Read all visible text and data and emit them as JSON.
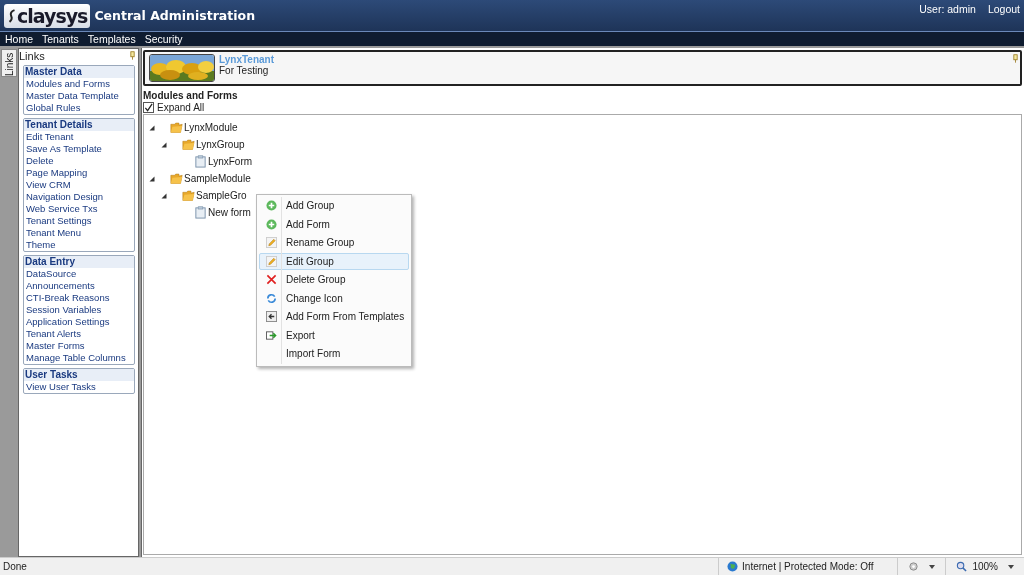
{
  "header": {
    "logo": "claysys",
    "title": "Central Administration",
    "user": "User: admin",
    "logout": "Logout"
  },
  "nav": [
    {
      "label": "Home"
    },
    {
      "label": "Tenants"
    },
    {
      "label": "Templates"
    },
    {
      "label": "Security"
    }
  ],
  "side_tab": "Links",
  "sidebar": {
    "title": "Links",
    "groups": [
      {
        "title": "Master Data",
        "items": [
          "Modules and Forms",
          "Master Data Template",
          "Global Rules"
        ]
      },
      {
        "title": "Tenant Details",
        "items": [
          "Edit Tenant",
          "Save As Template",
          "Delete",
          "Page Mapping",
          "View CRM",
          "Navigation Design",
          "Web Service Txs",
          "Tenant Settings",
          "Tenant Menu",
          "Theme"
        ]
      },
      {
        "title": "Data Entry",
        "items": [
          "DataSource",
          "Announcements",
          "CTI-Break Reasons",
          "Session Variables",
          "Application Settings",
          "Tenant Alerts",
          "Master Forms",
          "Manage Table Columns"
        ]
      },
      {
        "title": "User Tasks",
        "items": [
          "View User Tasks"
        ]
      }
    ]
  },
  "tenant": {
    "name": "LynxTenant",
    "description": "For Testing"
  },
  "section_title": "Modules and Forms",
  "expand_all": {
    "label": "Expand All",
    "checked": true
  },
  "tree": [
    {
      "label": "LynxModule",
      "kind": "module",
      "expanded": true,
      "children": [
        {
          "label": "LynxGroup",
          "kind": "group",
          "expanded": true,
          "children": [
            {
              "label": "LynxForm",
              "kind": "form"
            }
          ]
        }
      ]
    },
    {
      "label": "SampleModule",
      "kind": "module",
      "expanded": true,
      "children": [
        {
          "label": "SampleGro",
          "kind": "group",
          "expanded": true,
          "children": [
            {
              "label": "New form",
              "kind": "form"
            }
          ]
        }
      ]
    }
  ],
  "context_menu": [
    {
      "label": "Add Group",
      "kind": "add",
      "selected": false
    },
    {
      "label": "Add Form",
      "kind": "add",
      "selected": false
    },
    {
      "label": "Rename Group",
      "kind": "edit",
      "selected": false
    },
    {
      "label": "Edit Group",
      "kind": "edit",
      "selected": true
    },
    {
      "label": "Delete Group",
      "kind": "delete",
      "selected": false
    },
    {
      "label": "Change Icon",
      "kind": "refresh",
      "selected": false
    },
    {
      "label": "Add Form From Templates",
      "kind": "template",
      "selected": false
    },
    {
      "label": "Export",
      "kind": "export",
      "selected": false
    },
    {
      "label": "Import Form",
      "kind": "none",
      "selected": false
    }
  ],
  "status_bar": {
    "text": "Done",
    "zone": "Internet | Protected Mode: Off",
    "zoom": "100%"
  }
}
